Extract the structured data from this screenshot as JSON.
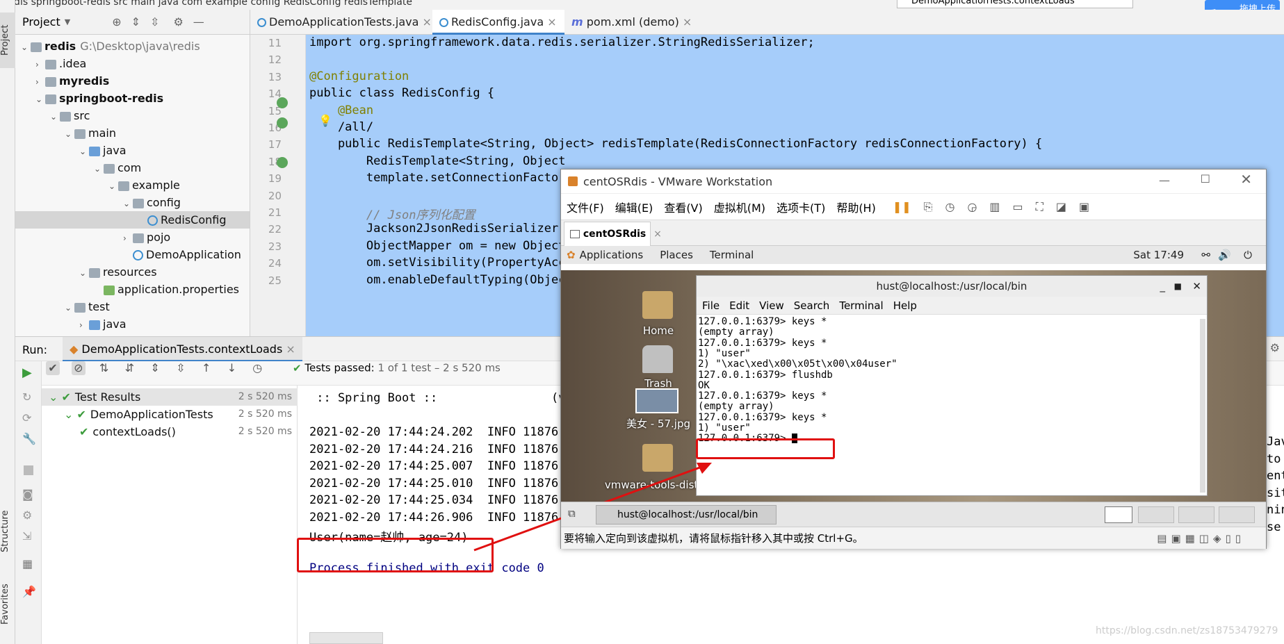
{
  "crumb": {
    "text": "redis  springboot-redis  src  main  java  com  example  config  RedisConfig  redisTemplate"
  },
  "run_config": "DemoApplicationTests.contextLoads",
  "upload_button": "拖拽上传",
  "left_strip": {
    "project": "Project",
    "structure": "Structure",
    "favorites": "Favorites"
  },
  "project": {
    "header": "Project",
    "tree": [
      {
        "label": "redis",
        "path": "G:\\Desktop\\java\\redis",
        "depth": 0,
        "kind": "folder",
        "bold": true
      },
      {
        "label": ".idea",
        "depth": 1,
        "kind": "folder"
      },
      {
        "label": "myredis",
        "depth": 1,
        "kind": "folder",
        "bold": true
      },
      {
        "label": "springboot-redis",
        "depth": 1,
        "kind": "folder",
        "bold": true
      },
      {
        "label": "src",
        "depth": 2,
        "kind": "folder"
      },
      {
        "label": "main",
        "depth": 3,
        "kind": "folder"
      },
      {
        "label": "java",
        "depth": 4,
        "kind": "folder-blue"
      },
      {
        "label": "com",
        "depth": 5,
        "kind": "folder"
      },
      {
        "label": "example",
        "depth": 6,
        "kind": "folder"
      },
      {
        "label": "config",
        "depth": 7,
        "kind": "folder"
      },
      {
        "label": "RedisConfig",
        "depth": 8,
        "kind": "class",
        "selected": true
      },
      {
        "label": "pojo",
        "depth": 7,
        "kind": "folder"
      },
      {
        "label": "DemoApplication",
        "depth": 7,
        "kind": "class"
      },
      {
        "label": "resources",
        "depth": 4,
        "kind": "folder"
      },
      {
        "label": "application.properties",
        "depth": 5,
        "kind": "file"
      },
      {
        "label": "test",
        "depth": 3,
        "kind": "folder"
      },
      {
        "label": "java",
        "depth": 4,
        "kind": "folder-blue"
      }
    ]
  },
  "editor": {
    "tabs": [
      "DemoApplicationTests.java",
      "RedisConfig.java",
      "pom.xml (demo)"
    ],
    "line_numbers": [
      "11",
      "12",
      "13",
      "14",
      "15",
      "16",
      "17",
      "18",
      "19",
      "20",
      "21",
      "22",
      "23",
      "24",
      "25"
    ],
    "lines": [
      "import org.springframework.data.redis.serializer.StringRedisSerializer;",
      "",
      "@Configuration",
      "public class RedisConfig {",
      "    @Bean",
      "    /all/",
      "    public RedisTemplate<String, Object> redisTemplate(RedisConnectionFactory redisConnectionFactory) {",
      "        RedisTemplate<String, Object",
      "        template.setConnectionFactory",
      "",
      "        // Json序列化配置",
      "        Jackson2JsonRedisSerializer j",
      "        ObjectMapper om = new ObjectM",
      "        om.setVisibility(PropertyAcce",
      "        om.enableDefaultTyping(Object"
    ]
  },
  "run": {
    "label": "Run:",
    "tab": "DemoApplicationTests.contextLoads",
    "status_prefix": "Tests passed:",
    "status_detail": "1 of 1 test – 2 s 520 ms",
    "tests": [
      {
        "name": "Test Results",
        "time": "2 s 520 ms",
        "depth": 0
      },
      {
        "name": "DemoApplicationTests",
        "time": "2 s 520 ms",
        "depth": 1
      },
      {
        "name": "contextLoads()",
        "time": "2 s 520 ms",
        "depth": 2
      }
    ],
    "console": [
      " :: Spring Boot ::                (v2",
      "",
      "2021-02-20 17:44:24.202  INFO 11876 -",
      "2021-02-20 17:44:24.216  INFO 11876 -",
      "2021-02-20 17:44:25.007  INFO 11876 -",
      "2021-02-20 17:44:25.010  INFO 11876 -",
      "2021-02-20 17:44:25.034  INFO 11876 -",
      "2021-02-20 17:44:26.906  INFO 11876 -",
      "User(name=赵帅, age=24)",
      "",
      "Process finished with exit code 0"
    ],
    "right_fragments": [
      "Java",
      "to c",
      "ente",
      "sit",
      "nin",
      "se"
    ]
  },
  "vmware": {
    "title": "centOSRdis - VMware Workstation",
    "menu": [
      "文件(F)",
      "编辑(E)",
      "查看(V)",
      "虚拟机(M)",
      "选项卡(T)",
      "帮助(H)"
    ],
    "tab": "centOSRdis",
    "gnome": {
      "applications": "Applications",
      "places": "Places",
      "terminal": "Terminal",
      "clock": "Sat 17:49"
    },
    "desktop_icons": [
      "Home",
      "Trash",
      "美女 - 57.jpg",
      "vmware-tools-distrib"
    ],
    "terminal": {
      "title": "hust@localhost:/usr/local/bin",
      "menu": [
        "File",
        "Edit",
        "View",
        "Search",
        "Terminal",
        "Help"
      ],
      "lines": [
        "127.0.0.1:6379> keys *",
        "(empty array)",
        "127.0.0.1:6379> keys *",
        "1) \"user\"",
        "2) \"\\xac\\xed\\x00\\x05t\\x00\\x04user\"",
        "127.0.0.1:6379> flushdb",
        "OK",
        "127.0.0.1:6379> keys *",
        "(empty array)",
        "127.0.0.1:6379> keys *",
        "1) \"user\"",
        "127.0.0.1:6379> "
      ]
    },
    "taskbar_item": "hust@localhost:/usr/local/bin",
    "status": "要将输入定向到该虚拟机，请将鼠标指针移入其中或按 Ctrl+G。"
  },
  "watermark": "https://blog.csdn.net/zs18753479279"
}
